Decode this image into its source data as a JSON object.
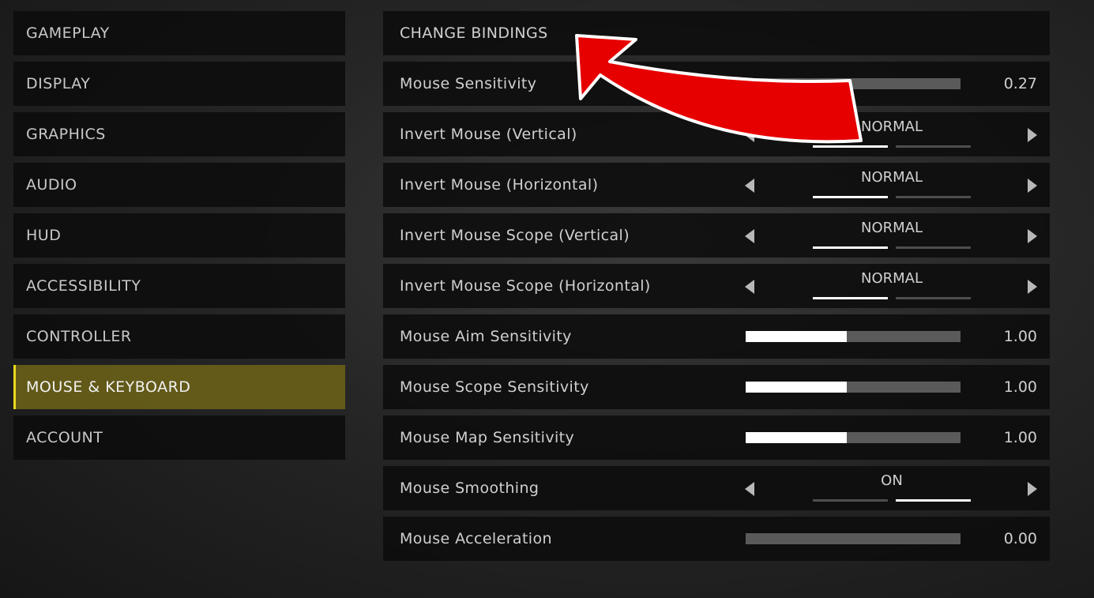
{
  "sidebar": {
    "items": [
      {
        "label": "GAMEPLAY",
        "active": false
      },
      {
        "label": "DISPLAY",
        "active": false
      },
      {
        "label": "GRAPHICS",
        "active": false
      },
      {
        "label": "AUDIO",
        "active": false
      },
      {
        "label": "HUD",
        "active": false
      },
      {
        "label": "ACCESSIBILITY",
        "active": false
      },
      {
        "label": "CONTROLLER",
        "active": false
      },
      {
        "label": "MOUSE & KEYBOARD",
        "active": true
      },
      {
        "label": "ACCOUNT",
        "active": false
      }
    ]
  },
  "settings": [
    {
      "type": "button",
      "label": "CHANGE BINDINGS"
    },
    {
      "type": "slider",
      "label": "Mouse Sensitivity",
      "value": "0.27",
      "fill": 0.03
    },
    {
      "type": "select",
      "label": "Invert Mouse (Vertical)",
      "value": "NORMAL",
      "index": 0
    },
    {
      "type": "select",
      "label": "Invert Mouse (Horizontal)",
      "value": "NORMAL",
      "index": 0
    },
    {
      "type": "select",
      "label": "Invert Mouse Scope (Vertical)",
      "value": "NORMAL",
      "index": 0
    },
    {
      "type": "select",
      "label": "Invert Mouse Scope (Horizontal)",
      "value": "NORMAL",
      "index": 0
    },
    {
      "type": "slider",
      "label": "Mouse Aim Sensitivity",
      "value": "1.00",
      "fill": 0.47
    },
    {
      "type": "slider",
      "label": "Mouse Scope Sensitivity",
      "value": "1.00",
      "fill": 0.47
    },
    {
      "type": "slider",
      "label": "Mouse Map Sensitivity",
      "value": "1.00",
      "fill": 0.47
    },
    {
      "type": "select",
      "label": "Mouse Smoothing",
      "value": "ON",
      "index": 1
    },
    {
      "type": "slider",
      "label": "Mouse Acceleration",
      "value": "0.00",
      "fill": 0
    }
  ],
  "annotation": {
    "icon": "red-curved-arrow-icon",
    "color": "#e60000"
  },
  "colors": {
    "accent": "#e8d820",
    "active_bg": "#6e6419"
  }
}
